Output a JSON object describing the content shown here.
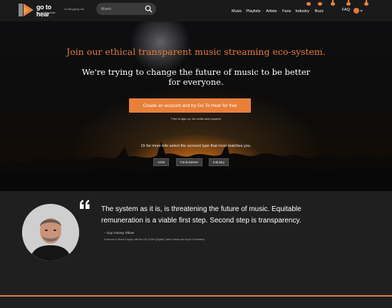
{
  "header": {
    "logo_go": "go",
    "logo_hear": "to hear",
    "logo_tagline": "we pay the music",
    "blog_link": "on Blogging ute",
    "search_placeholder": "Music",
    "nav": [
      {
        "label": "Music"
      },
      {
        "label": "Playlists"
      },
      {
        "label": "Artists"
      },
      {
        "label": "Fans"
      },
      {
        "label": "Industry"
      },
      {
        "label": "Buzz"
      }
    ],
    "faq_label": "FAQ"
  },
  "hero": {
    "heading": "Join our ethical transparent music streaming eco-system.",
    "sub_line1": "We're trying to change the future of music to be better",
    "sub_line2": "for everyone.",
    "cta_label": "Create an account and try Go To Hear for free",
    "cta_note": "Free to sign up. No credit card required",
    "more_info": "Or for more info select the account type that most matches you.",
    "account_types": [
      {
        "label": "Artist"
      },
      {
        "label": "Fan/Listener"
      },
      {
        "label": "Industry"
      }
    ]
  },
  "quote": {
    "text": "The system as it is, is threatening the future of music. Equitable remuneration is a viable first step. Second step is transparency.",
    "author": "– Guy Garvey, Elbow",
    "note": "Evidence to Music Enquiry with the UK DCMS (Digital Culture Media and Sport Committee)"
  },
  "colors": {
    "accent": "#e8803a",
    "background": "#1f1f1f",
    "header": "#1a1a1a"
  },
  "icons": [
    "logo-mark-icon",
    "search-icon",
    "chevron-down-icon",
    "quote-mark-icon"
  ]
}
